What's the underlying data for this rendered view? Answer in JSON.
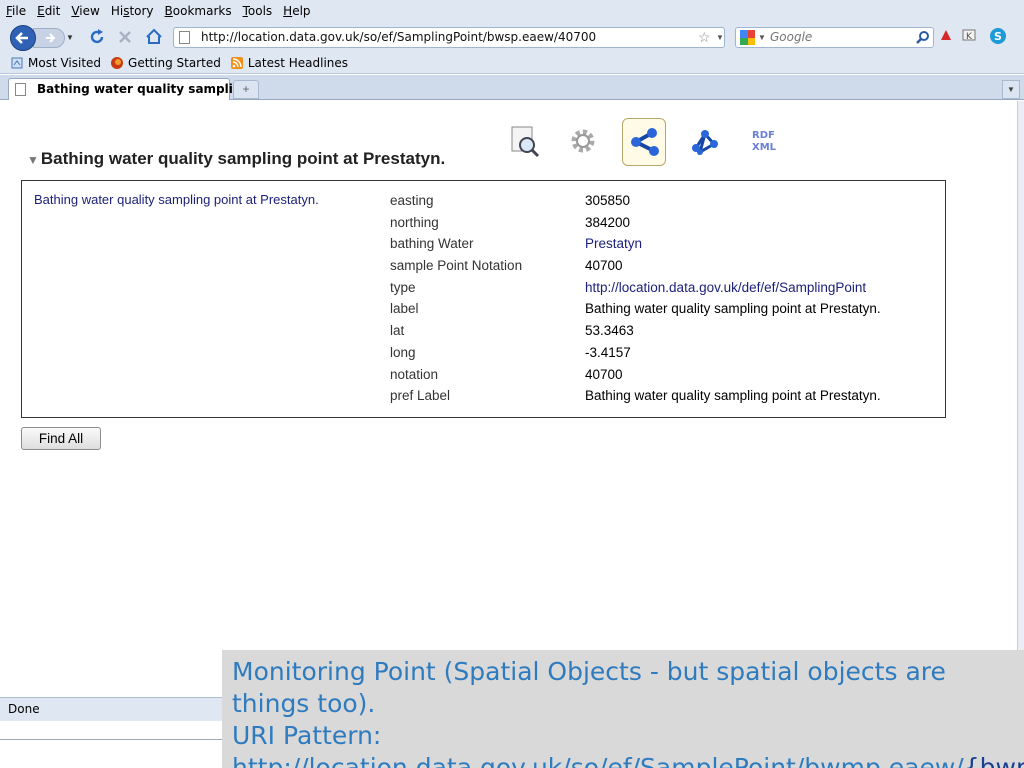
{
  "menu": [
    {
      "pre": "",
      "u": "F",
      "post": "ile"
    },
    {
      "pre": "",
      "u": "E",
      "post": "dit"
    },
    {
      "pre": "",
      "u": "V",
      "post": "iew"
    },
    {
      "pre": "Hi",
      "u": "s",
      "post": "tory"
    },
    {
      "pre": "",
      "u": "B",
      "post": "ookmarks"
    },
    {
      "pre": "",
      "u": "T",
      "post": "ools"
    },
    {
      "pre": "",
      "u": "H",
      "post": "elp"
    }
  ],
  "address": {
    "url": "http://location.data.gov.uk/so/ef/SamplingPoint/bwsp.eaew/40700"
  },
  "search": {
    "placeholder": "Google"
  },
  "bookmarks": [
    {
      "label": "Most Visited",
      "icon": "most-visited-icon"
    },
    {
      "label": "Getting Started",
      "icon": "firefox-icon"
    },
    {
      "label": "Latest Headlines",
      "icon": "rss-icon"
    }
  ],
  "tab": {
    "title": "Bathing water quality sampli...",
    "new_tab": "+"
  },
  "page": {
    "title": "Bathing water quality sampling point at Prestatyn.",
    "subject": "Bathing water quality sampling point at Prestatyn.",
    "properties": [
      {
        "key": "easting",
        "value": "305850",
        "link": false
      },
      {
        "key": "northing",
        "value": "384200",
        "link": false
      },
      {
        "key": "bathing Water",
        "value": "Prestatyn",
        "link": true
      },
      {
        "key": "sample Point Notation",
        "value": "40700",
        "link": false
      },
      {
        "key": "type",
        "value": "http://location.data.gov.uk/def/ef/SamplingPoint",
        "link": true
      },
      {
        "key": "label",
        "value": "Bathing water quality sampling point at Prestatyn.",
        "link": false
      },
      {
        "key": "lat",
        "value": "53.3463",
        "link": false
      },
      {
        "key": "long",
        "value": "-3.4157",
        "link": false
      },
      {
        "key": "notation",
        "value": "40700",
        "link": false
      },
      {
        "key": "pref Label",
        "value": "Bathing water quality sampling point at Prestatyn.",
        "link": false
      }
    ],
    "find_all_label": "Find All",
    "rdf_xml_label_top": "RDF",
    "rdf_xml_label_bottom": "XML"
  },
  "status": {
    "text": "Done"
  },
  "caption": {
    "line1": "Monitoring Point (Spatial Objects - but spatial objects are things too).",
    "line2": "URI Pattern:",
    "uri_prefix": "http://location.data.gov.uk/so/ef/SamplePoint/bwmp.eaew/",
    "uri_var": "{bwmpId}"
  },
  "colors": {
    "link": "#1b1f7a",
    "caption_text": "#2e7bbf",
    "chrome": "#dfe7f2"
  }
}
